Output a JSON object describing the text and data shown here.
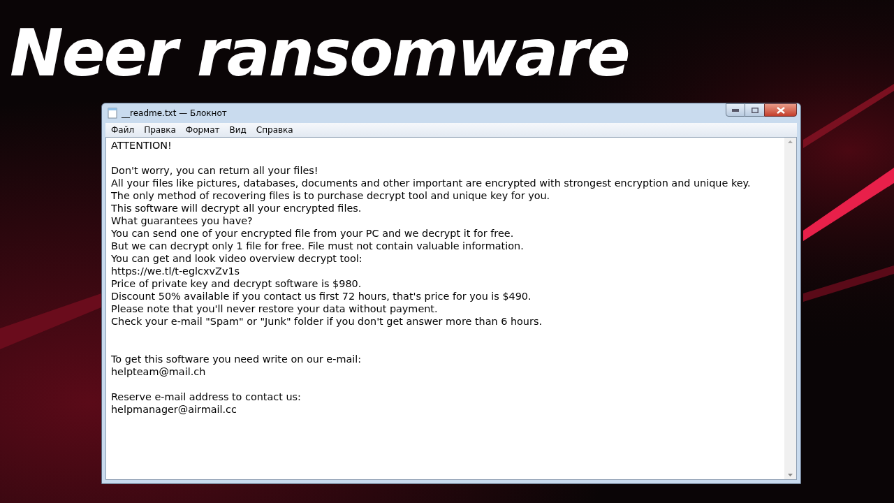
{
  "headline": "Neer ransomware",
  "window": {
    "title": "__readme.txt — Блокнот"
  },
  "menu": [
    "Файл",
    "Правка",
    "Формат",
    "Вид",
    "Справка"
  ],
  "lines": [
    {
      "kind": "text",
      "text": "ATTENTION!"
    },
    {
      "kind": "blank"
    },
    {
      "kind": "text",
      "text": "Don't worry, you can return all your files!"
    },
    {
      "kind": "text",
      "text": "All your files like pictures, databases, documents and other important are encrypted with strongest encryption and unique key."
    },
    {
      "kind": "text",
      "text": "The only method of recovering files is to purchase decrypt tool and unique key for you."
    },
    {
      "kind": "text",
      "text": "This software will decrypt all your encrypted files."
    },
    {
      "kind": "text",
      "text": "What guarantees you have?"
    },
    {
      "kind": "text",
      "text": "You can send one of your encrypted file from your PC and we decrypt it for free."
    },
    {
      "kind": "text",
      "text": "But we can decrypt only 1 file for free. File must not contain valuable information."
    },
    {
      "kind": "text",
      "text": "You can get and look video overview decrypt tool:"
    },
    {
      "kind": "text",
      "text": "https://we.tl/t-eglcxvZv1s"
    },
    {
      "kind": "text",
      "text": "Price of private key and decrypt software is $980."
    },
    {
      "kind": "text",
      "text": "Discount 50% available if you contact us first 72 hours, that's price for you is $490."
    },
    {
      "kind": "text",
      "text": "Please note that you'll never restore your data without payment."
    },
    {
      "kind": "text",
      "text": "Check your e-mail \"Spam\" or \"Junk\" folder if you don't get answer more than 6 hours."
    },
    {
      "kind": "blank"
    },
    {
      "kind": "blank"
    },
    {
      "kind": "text",
      "text": "To get this software you need write on our e-mail:"
    },
    {
      "kind": "text",
      "text": "helpteam@mail.ch"
    },
    {
      "kind": "blank"
    },
    {
      "kind": "text",
      "text": "Reserve e-mail address to contact us:"
    },
    {
      "kind": "text",
      "text": "helpmanager@airmail.cc"
    }
  ]
}
